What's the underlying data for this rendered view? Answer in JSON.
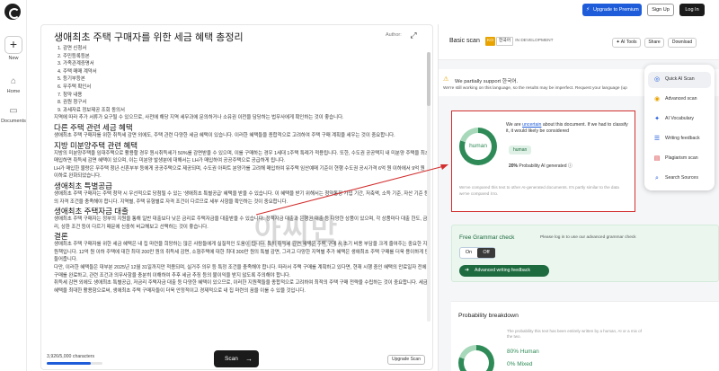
{
  "rail": {
    "new_label": "New",
    "home_label": "Home",
    "documents_label": "Documents"
  },
  "header": {
    "upgrade_premium": "Upgrade to Premium",
    "sign_up": "Sign Up",
    "log_in": "Log In"
  },
  "editor": {
    "title": "생애최초 주택 구매자를 위한 세금 혜택 총정리",
    "author_label": "Author:",
    "list_items": [
      "1. 감면 신청서",
      "2. 주민등록등본",
      "3. 가족관계증명서",
      "4. 주택 매매 계약서",
      "5. 등기부등본",
      "6. 무주택 확인서",
      "7. 청약 내용",
      "8. 권원 청구서",
      "9. 과세자료 정보제공 조회 동의서"
    ],
    "p1": "지역에 따라 추가 서류가 요구될 수 있으므로, 사전에 해당 지역 세무과에 문의하거나 소유권 이전을 담당하는 법무사에게 확인하는 것이 좋습니다.",
    "h1": "다른 주택 관련 세금 혜택",
    "p2": "생애최초 주택 구매자를 위한 취득세 감면 외에도, 주택 관련 다양한 세금 혜택이 있습니다. 이러한 혜택들을 종합적으로 고려하여 주택 구매 계획을 세우는 것이 중요합니다.",
    "h2": "지방 미분양주택 관련 혜택",
    "p3": "지방의 미분양주택을 임대주택으로 활용할 경우 원시취득세가 50%를 감면받을 수 있으며, 이를 구매하는 경우 1세대 1주택 특례가 적용됩니다. 또한, 수도권 공공택지 내 미분양 주택을 최초 매입하면 취득세 감면 혜택이 있으며, 이는 미분양 발생분에 대해서는 LH가 매입하여 공공주택으로 공급하게 됩니다.",
    "p4": "LH가 매입한 물량은 무주택 청년·신혼부부 등에게 공공주택으로 제공되며, 수도권 아파트 분양가를 고려해 매입하여 유주택 임산예매 기준이 현행 수도권 공시가격 6억 원 이하에서 9억 원 이하로 완화되었습니다.",
    "h3": "생애최초 특별공급",
    "p5": "생애최초 주택 구매자는 주택 청약 시 우선적으로 당첨될 수 있는 '생애최초 특별공급' 혜택을 받을 수 있습니다. 이 혜택을 받기 위해서는 청약통장 가입 기간, 저축액, 소득 기준, 자산 기준 등의 자격 조건을 충족해야 합니다. 지역별, 주택 유형별로 자격 조건이 다르므로 세부 사항을 확인하는 것이 중요합니다.",
    "h4": "생애최초 주택자금 대출",
    "p6": "생애최초 주택 구매자는 정부의 지원을 통해 일반 대출보다 낮은 금리로 주택자금을 대출받을 수 있습니다. 정책자금 대출과 은행권 대출 등 다양한 상품이 있으며, 각 상품마다 대출 한도, 금리, 상환 조건 등이 다르기 때문에 신중히 비교해보고 선택하는 것이 좋습니다.",
    "h5": "결론",
    "p7": "생애최초 주택 구매자를 위한 세금 혜택은 내 집 마련을 희망하는 많은 사람들에게 실질적인 도움이 됩니다. 특히 취득세 감면 혜택은 주택 구매 시 초기 비용 부담을 크게 줄여주는 중요한 지원책입니다. 12억 원 이하 주택에 대한 최대 200만 원의 취득세 감면, 소형주택에 대한 최대 300만 원의 특별 감면, 그리고 다양한 지역별 추가 혜택은 생애최초 주택 구매를 더욱 용이하게 만들어줍니다.",
    "p8": "다만, 이러한 혜택들은 대부분 2025년 12월 31일까지만 적용되며, 실거주 의무 등 특정 조건을 충족해야 합니다. 따라서 주택 구매를 계획하고 있다면, 현재 시행 중인 혜택의 만료일자 전에 구매를 완료하고, 관련 조건과 의무사항을 충분히 이해하여 추후 세금 추징 등의 불이익을 받지 않도록 주의해야 합니다.",
    "p9": "취득세 감면 외에도 생애최초 특별공급, 저금리 주택자금 대출 등 다양한 혜택이 있으므로, 이러한 지원책들을 종합적으로 고려하여 최적의 주택 구매 전략을 수립하는 것이 중요합니다. 세금 혜택을 최대한 활용함으로써, 생애최초 주택 구매자들이 더욱 안정적이고 경제적으로 내 집 마련의 꿈을 이룰 수 있을 것입니다.",
    "char_count": "3,926/5,000 characters",
    "char_progress": 0.785,
    "scan_label": "Scan",
    "upgrade_scan": "Upgrade Scan"
  },
  "watermark": {
    "big": "아씨만",
    "small": "JTENNAGOM.COM"
  },
  "panel": {
    "scan_mode": "Basic scan",
    "lang_code": "KO",
    "lang_native": "한국어",
    "lang_status": "IN DEVELOPMENT",
    "ai_tools": "AI Tools",
    "share": "Share",
    "download": "Download",
    "partial_support": "We partially support 한국어.",
    "partial_detail": "We're still working on this language, so the results may be imperfect. Request your language (up",
    "result": {
      "classification": "human",
      "verdict_pre": "We are ",
      "verdict_word": "uncertain",
      "verdict_post": " about this document. If we had to classify it, it would likely be considered",
      "tag": "human",
      "prob_pct": "20%",
      "prob_label": "Probability AI generated",
      "compare_note": "We've compared this text to other AI-generated documents. It's partly similar to the data we've compared it to.",
      "human_fraction": 0.8
    },
    "grammar": {
      "title": "Free Grammar check",
      "message": "Please log in to use our advanced grammar check",
      "on": "On",
      "off": "Off",
      "advanced": "Advanced writing feedback"
    },
    "breakdown": {
      "title": "Probability breakdown",
      "desc": "The probability this text has been entirely written by a human, AI or a mix of the two.",
      "human": "80% Human",
      "mixed": "0% Mixed"
    }
  },
  "tools_menu": {
    "items": [
      {
        "label": "Quick AI Scan",
        "icon": "scan-icon",
        "color": "#1f5cd9"
      },
      {
        "label": "Advanced scan",
        "icon": "advanced-scan-icon",
        "color": "#e8a300"
      },
      {
        "label": "AI Vocabulary",
        "icon": "vocabulary-icon",
        "color": "#1f5cd9"
      },
      {
        "label": "Writing feedback",
        "icon": "feedback-icon",
        "color": "#1f5cd9"
      },
      {
        "label": "Plagiarism scan",
        "icon": "plagiarism-icon",
        "color": "#d32f2f"
      },
      {
        "label": "Search Sources",
        "icon": "sources-icon",
        "color": "#1f5cd9"
      }
    ]
  }
}
